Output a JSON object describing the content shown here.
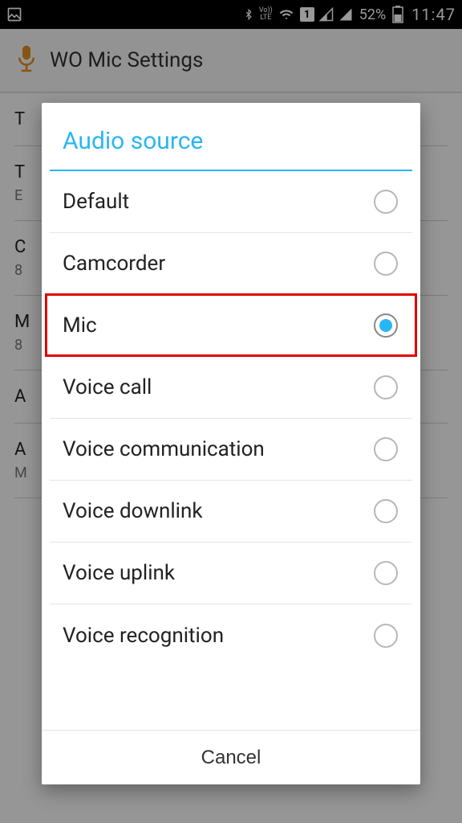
{
  "statusbar": {
    "battery_text": "52%",
    "clock": "11:47",
    "icons": {
      "picture": "picture-icon",
      "bluetooth": "bluetooth-icon",
      "volte": "Vo)) LTE",
      "wifi": "wifi-icon",
      "sim1": "1",
      "signal1": "signal-icon",
      "signal2": "signal-icon",
      "battery": "battery-icon"
    }
  },
  "appheader": {
    "title": "WO Mic Settings"
  },
  "bg": {
    "rows": [
      {
        "label": "T",
        "sub": ""
      },
      {
        "label": "T",
        "sub": "E"
      },
      {
        "label": "C",
        "sub": "8"
      },
      {
        "label": "M",
        "sub": "8"
      },
      {
        "label": "A",
        "sub": ""
      },
      {
        "label": "A",
        "sub": "M"
      }
    ]
  },
  "dialog": {
    "title": "Audio source",
    "options": [
      {
        "label": "Default",
        "selected": false
      },
      {
        "label": "Camcorder",
        "selected": false
      },
      {
        "label": "Mic",
        "selected": true
      },
      {
        "label": "Voice call",
        "selected": false
      },
      {
        "label": "Voice communication",
        "selected": false
      },
      {
        "label": "Voice downlink",
        "selected": false
      },
      {
        "label": "Voice uplink",
        "selected": false
      },
      {
        "label": "Voice recognition",
        "selected": false
      }
    ],
    "cancel": "Cancel",
    "highlight_index": 2
  }
}
